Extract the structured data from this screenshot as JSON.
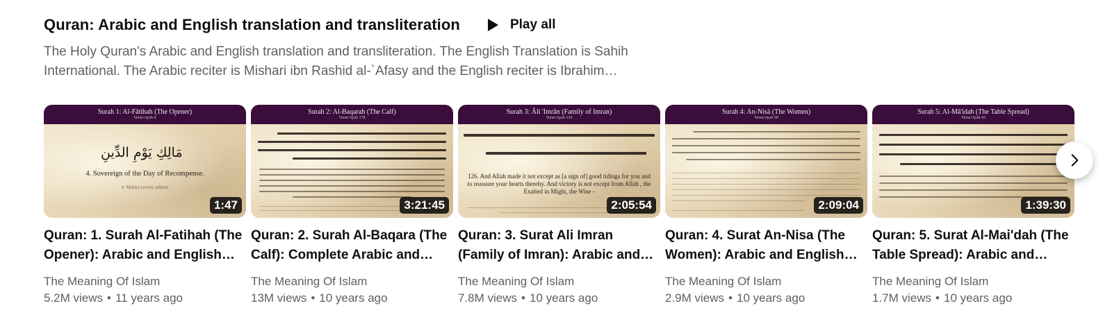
{
  "shelf": {
    "title": "Quran: Arabic and English translation and transliteration",
    "play_all_label": "Play all",
    "description": "The Holy Quran's Arabic and English translation and transliteration. The English Translation is Sahih International. The Arabic reciter is Mishari ibn Rashid al-`Afasy and the English reciter is Ibrahim…"
  },
  "videos": [
    {
      "title": "Quran: 1. Surah Al-Fatihah (The Opener): Arabic and English translation HD",
      "channel": "The Meaning Of Islam",
      "views": "5.2M views",
      "age": "11 years ago",
      "duration": "1:47",
      "thumb_heading": "Surah 1: Al-Fâtihah (The Opener)",
      "thumb_sub": "Verse/Ayah 4",
      "thumb_arabic": "مَالِكِ يَوْمِ الدِّينِ",
      "thumb_english": "4. Sovereign of the Day of Recompense.",
      "thumb_translit": "4. Maliki yawmi addeen"
    },
    {
      "title": "Quran: 2. Surah Al-Baqara (The Calf): Complete Arabic and English translation",
      "channel": "The Meaning Of Islam",
      "views": "13M views",
      "age": "10 years ago",
      "duration": "3:21:45",
      "thumb_heading": "Surah 2: Al-Baqarah (The Calf)",
      "thumb_sub": "Verse/Ayah 178"
    },
    {
      "title": "Quran: 3. Surat Ali Imran (Family of Imran): Arabic and English translation",
      "channel": "The Meaning Of Islam",
      "views": "7.8M views",
      "age": "10 years ago",
      "duration": "2:05:54",
      "thumb_heading": "Surah 3: Âli 'Imrân (Family of Imran)",
      "thumb_sub": "Verse/Ayah 126",
      "thumb_english": "126. And Allah made it not except as [a sign of] good tidings for you and to reassure your hearts thereby. And victory is not except from Allah , the Exalted in Might, the Wise -"
    },
    {
      "title": "Quran: 4. Surat An-Nisa (The Women): Arabic and English translation",
      "channel": "The Meaning Of Islam",
      "views": "2.9M views",
      "age": "10 years ago",
      "duration": "2:09:04",
      "thumb_heading": "Surah 4: An-Nisâ (The Women)",
      "thumb_sub": "Verse/Ayah 90"
    },
    {
      "title": "Quran: 5. Surat Al-Mai'dah (The Table Spread): Arabic and English translation",
      "channel": "The Meaning Of Islam",
      "views": "1.7M views",
      "age": "10 years ago",
      "duration": "1:39:30",
      "thumb_heading": "Surah 5: Al-Mâ'idah (The Table Spread)",
      "thumb_sub": "Verse/Ayah 43"
    }
  ],
  "meta_separator": "•",
  "icons": {
    "play": "play-icon",
    "next": "chevron-right-icon"
  },
  "colors": {
    "thumb_header": "#3a0d3c",
    "text_primary": "#0f0f0f",
    "text_secondary": "#606060"
  }
}
